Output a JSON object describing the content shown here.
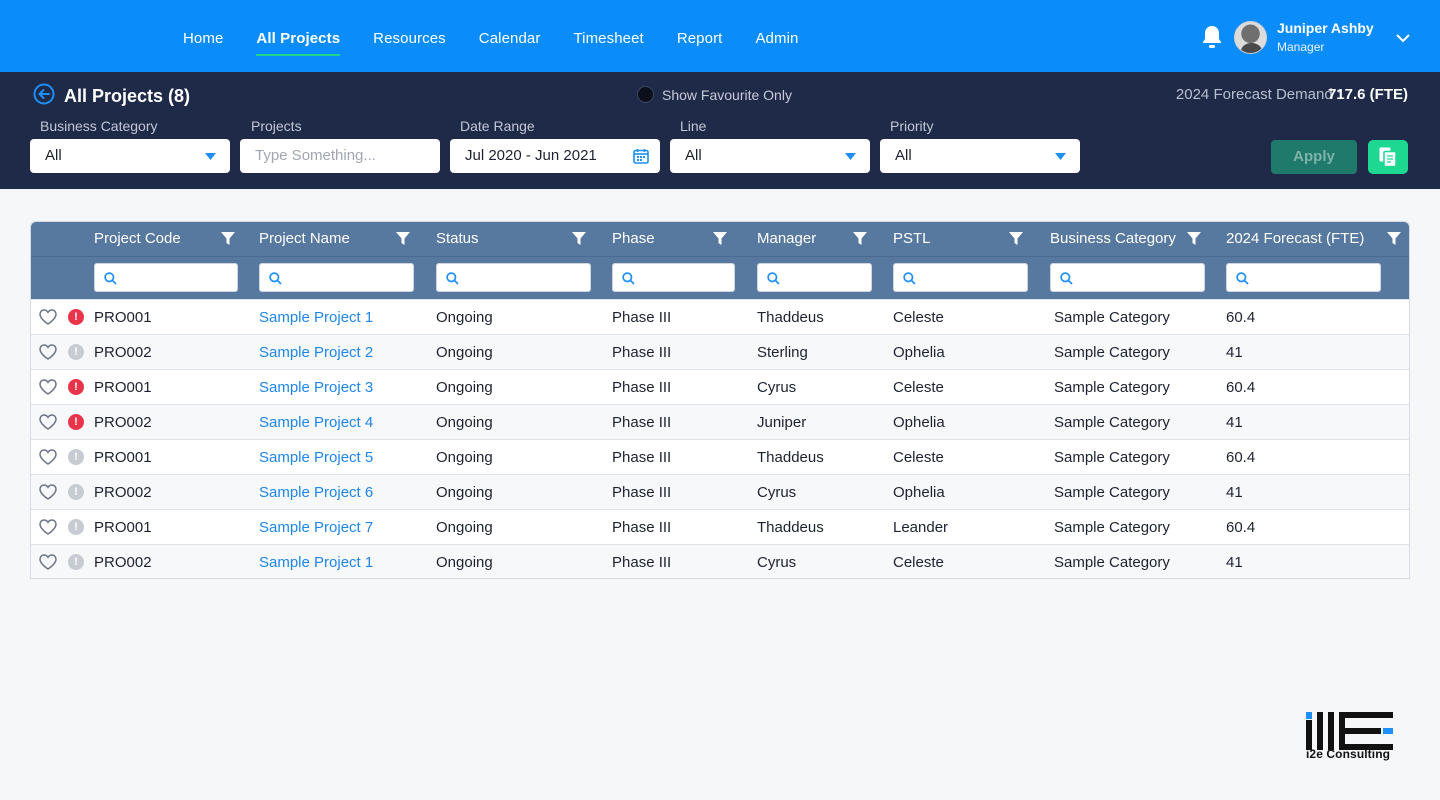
{
  "nav": {
    "items": [
      {
        "label": "Home",
        "active": false
      },
      {
        "label": "All Projects",
        "active": true
      },
      {
        "label": "Resources",
        "active": false
      },
      {
        "label": "Calendar",
        "active": false
      },
      {
        "label": "Timesheet",
        "active": false
      },
      {
        "label": "Report",
        "active": false
      },
      {
        "label": "Admin",
        "active": false
      }
    ]
  },
  "user": {
    "name": "Juniper Ashby",
    "role": "Manager"
  },
  "header": {
    "title": "All Projects (8)",
    "favourite_label": "Show Favourite Only",
    "forecast_label": "2024 Forecast Demand :",
    "forecast_value": "717.6 (FTE)"
  },
  "filters": {
    "business_category": {
      "label": "Business Category",
      "value": "All"
    },
    "projects": {
      "label": "Projects",
      "placeholder": "Type Something..."
    },
    "date_range": {
      "label": "Date Range",
      "value": "Jul 2020 - Jun 2021"
    },
    "line": {
      "label": "Line",
      "value": "All"
    },
    "priority": {
      "label": "Priority",
      "value": "All"
    },
    "apply_label": "Apply"
  },
  "table": {
    "columns": [
      "Project Code",
      "Project Name",
      "Status",
      "Phase",
      "Manager",
      "PSTL",
      "Business Category",
      "2024 Forecast (FTE)"
    ],
    "rows": [
      {
        "priority": "high",
        "code": "PRO001",
        "name": "Sample Project 1",
        "status": "Ongoing",
        "phase": "Phase III",
        "manager": "Thaddeus",
        "pstl": "Celeste",
        "category": "Sample Category",
        "forecast": "60.4"
      },
      {
        "priority": "low",
        "code": "PRO002",
        "name": "Sample Project 2",
        "status": "Ongoing",
        "phase": "Phase III",
        "manager": "Sterling",
        "pstl": "Ophelia",
        "category": "Sample Category",
        "forecast": "41"
      },
      {
        "priority": "high",
        "code": "PRO001",
        "name": "Sample Project 3",
        "status": "Ongoing",
        "phase": "Phase III",
        "manager": "Cyrus",
        "pstl": "Celeste",
        "category": "Sample Category",
        "forecast": "60.4"
      },
      {
        "priority": "high",
        "code": "PRO002",
        "name": "Sample Project 4",
        "status": "Ongoing",
        "phase": "Phase III",
        "manager": "Juniper",
        "pstl": "Ophelia",
        "category": "Sample Category",
        "forecast": "41"
      },
      {
        "priority": "low",
        "code": "PRO001",
        "name": "Sample Project 5",
        "status": "Ongoing",
        "phase": "Phase III",
        "manager": "Thaddeus",
        "pstl": "Celeste",
        "category": "Sample Category",
        "forecast": "60.4"
      },
      {
        "priority": "low",
        "code": "PRO002",
        "name": "Sample Project 6",
        "status": "Ongoing",
        "phase": "Phase III",
        "manager": "Cyrus",
        "pstl": "Ophelia",
        "category": "Sample Category",
        "forecast": "41"
      },
      {
        "priority": "low",
        "code": "PRO001",
        "name": "Sample Project 7",
        "status": "Ongoing",
        "phase": "Phase III",
        "manager": "Thaddeus",
        "pstl": "Leander",
        "category": "Sample Category",
        "forecast": "60.4"
      },
      {
        "priority": "low",
        "code": "PRO002",
        "name": "Sample Project 1",
        "status": "Ongoing",
        "phase": "Phase III",
        "manager": "Cyrus",
        "pstl": "Celeste",
        "category": "Sample Category",
        "forecast": "41"
      }
    ]
  },
  "brand": {
    "name": "i2e Consulting"
  },
  "colors": {
    "nav": "#0a8cfb",
    "band": "#1f2a48",
    "table_header": "#58799f",
    "link": "#1f86e8",
    "priority_high": "#e8334a",
    "accent": "#1ed891"
  },
  "icons": {
    "nav": [
      "bell-icon",
      "chevron-down-icon"
    ],
    "row": [
      "heart-icon",
      "priority-icon"
    ],
    "filters": [
      "caret-down-icon",
      "calendar-icon",
      "copy-icon",
      "funnel-icon",
      "search-icon"
    ]
  }
}
